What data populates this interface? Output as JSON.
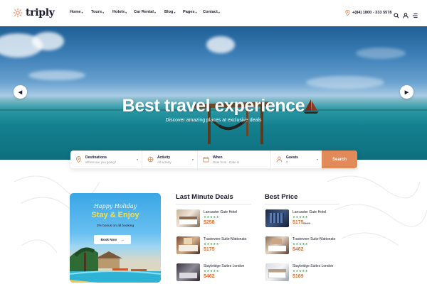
{
  "brand": {
    "name": "triply",
    "accent": "#e28a5a"
  },
  "nav": {
    "items": [
      {
        "label": "Home"
      },
      {
        "label": "Tours"
      },
      {
        "label": "Hotels"
      },
      {
        "label": "Car Rental"
      },
      {
        "label": "Blog"
      },
      {
        "label": "Pages"
      },
      {
        "label": "Contact"
      }
    ]
  },
  "header": {
    "phone": "+(84) 1800 - 333 5578",
    "icons": [
      "phone-pin-icon",
      "search-icon",
      "user-icon",
      "menu-icon"
    ]
  },
  "hero": {
    "title": "Best travel experience",
    "subtitle": "Discover amazing places at exclusive deals",
    "prev_icon": "arrow-left-icon",
    "next_icon": "arrow-right-icon"
  },
  "search": {
    "fields": [
      {
        "label": "Destinations",
        "value": "Where are you going?",
        "icon": "location-pin-icon"
      },
      {
        "label": "Activity",
        "value": "All activity",
        "icon": "activity-icon"
      },
      {
        "label": "When",
        "value": "Date from - Date to",
        "icon": "calendar-icon"
      },
      {
        "label": "Guests",
        "value": "0",
        "icon": "guests-icon"
      }
    ],
    "button": "Search"
  },
  "promo": {
    "script": "Happy Holiday",
    "headline": "Stay & Enjoy",
    "discount": "3% bonus on all booking",
    "button": "Book Now"
  },
  "last_minute": {
    "title": "Last Minute Deals",
    "items": [
      {
        "name": "Lancaster Gate Hotel",
        "stars": "★★★★★",
        "price": "$258",
        "old_price": ""
      },
      {
        "name": "Trastevere Suite-Mattonato",
        "stars": "★★★★★",
        "price": "$175",
        "old_price": ""
      },
      {
        "name": "Staybridge Suites London",
        "stars": "★★★★★",
        "price": "$462",
        "old_price": ""
      }
    ]
  },
  "best_price": {
    "title": "Best Price",
    "items": [
      {
        "name": "Lancaster Gate Hotel",
        "stars": "★★★★★",
        "price": "$175",
        "old_price": "$196"
      },
      {
        "name": "Trastevere Suite-Mattonato",
        "stars": "★★★★★",
        "price": "$462",
        "old_price": ""
      },
      {
        "name": "Staybridge Suites London",
        "stars": "★★★★★",
        "price": "$169",
        "old_price": ""
      }
    ]
  }
}
